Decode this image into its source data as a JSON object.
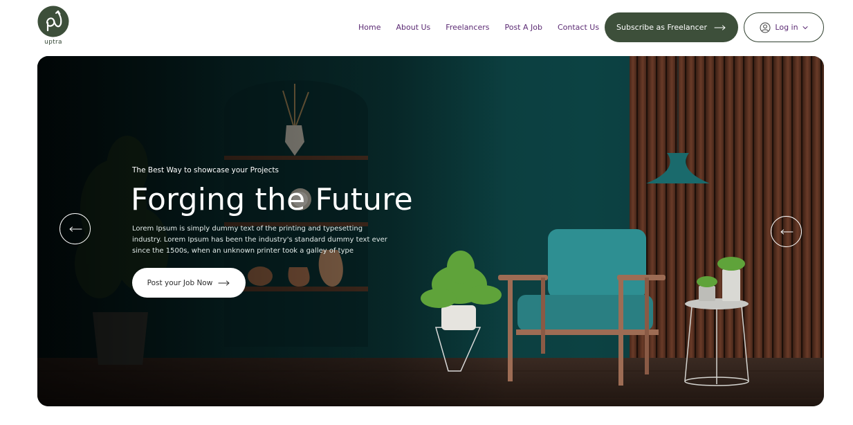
{
  "brand": {
    "name": "uptra",
    "accent": "#3d4f3a",
    "nav_color": "#5b2a73"
  },
  "nav": {
    "items": [
      {
        "label": "Home"
      },
      {
        "label": "About Us"
      },
      {
        "label": "Freelancers"
      },
      {
        "label": "Post A Job"
      },
      {
        "label": "Contact Us"
      }
    ]
  },
  "header": {
    "subscribe_label": "Subscribe as Freelancer",
    "login_label": "Log in"
  },
  "hero": {
    "eyebrow": "The Best Way to showcase your Projects",
    "title": "Forging the Future",
    "body": "Lorem Ipsum is simply dummy text of the printing and typesetting industry. Lorem Ipsum has been the industry's standard dummy text ever since the 1500s, when an unknown printer took a galley of type",
    "cta_label": "Post your Job Now",
    "prev_icon": "arrow-left-icon",
    "next_icon": "arrow-left-icon"
  }
}
